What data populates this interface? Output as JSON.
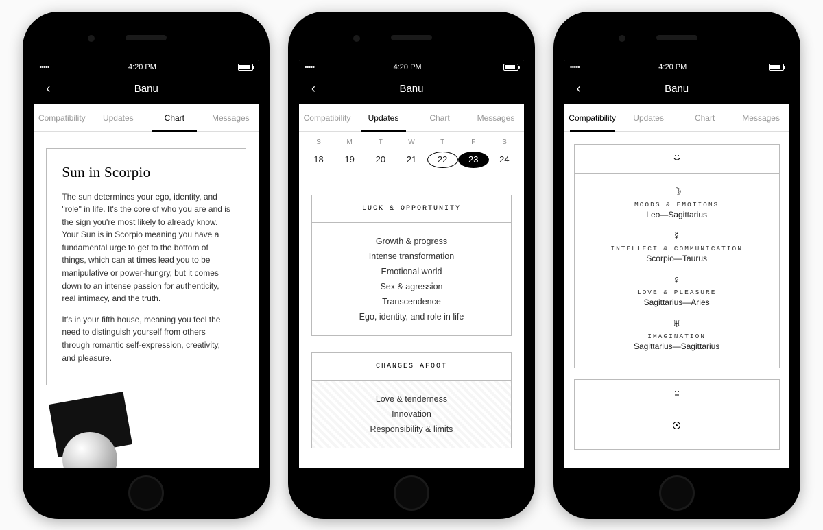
{
  "status": {
    "time": "4:20 PM"
  },
  "nav": {
    "title": "Banu"
  },
  "tabs": [
    "Compatibility",
    "Updates",
    "Chart",
    "Messages"
  ],
  "phone1": {
    "activeTab": "Chart",
    "card": {
      "title": "Sun in Scorpio",
      "para1": "The sun determines your ego, identity, and \"role\" in life. It's the core of who you are and is the sign you're most likely to already know. Your Sun is in Scorpio meaning you have a fundamental urge to get to the bottom of things, which can at times lead you to be manipulative or power-hungry, but it comes down to an intense passion for authenticity, real intimacy, and the truth.",
      "para2": "It's in your fifth house, meaning you feel the need to distinguish yourself from others through romantic self-expression, creativity, and pleasure."
    }
  },
  "phone2": {
    "activeTab": "Updates",
    "weekdays": [
      "S",
      "M",
      "T",
      "W",
      "T",
      "F",
      "S"
    ],
    "dates": [
      {
        "n": "18"
      },
      {
        "n": "19"
      },
      {
        "n": "20"
      },
      {
        "n": "21"
      },
      {
        "n": "22",
        "outlined": true
      },
      {
        "n": "23",
        "selected": true
      },
      {
        "n": "24"
      }
    ],
    "sections": [
      {
        "title": "LUCK & OPPORTUNITY",
        "items": [
          "Growth & progress",
          "Intense transformation",
          "Emotional world",
          "Sex & agression",
          "Transcendence",
          "Ego, identity, and role in life"
        ]
      },
      {
        "title": "CHANGES AFOOT",
        "hatched": true,
        "items": [
          "Love & tenderness",
          "Innovation",
          "Responsibility & limits"
        ]
      }
    ]
  },
  "phone3": {
    "activeTab": "Compatibility",
    "cards": [
      {
        "mood": "smiley",
        "items": [
          {
            "icon": "☽",
            "label": "MOODS & EMOTIONS",
            "pair": "Leo—Sagittarius"
          },
          {
            "icon": "☿",
            "label": "INTELLECT & COMMUNICATION",
            "pair": "Scorpio—Taurus"
          },
          {
            "icon": "♀",
            "label": "LOVE & PLEASURE",
            "pair": "Sagittarius—Aries"
          },
          {
            "icon": "♅",
            "label": "IMAGINATION",
            "pair": "Sagittarius—Sagittarius"
          }
        ]
      },
      {
        "mood": "neutral",
        "items": [
          {
            "icon": "sun",
            "label": "",
            "pair": ""
          }
        ]
      }
    ]
  }
}
